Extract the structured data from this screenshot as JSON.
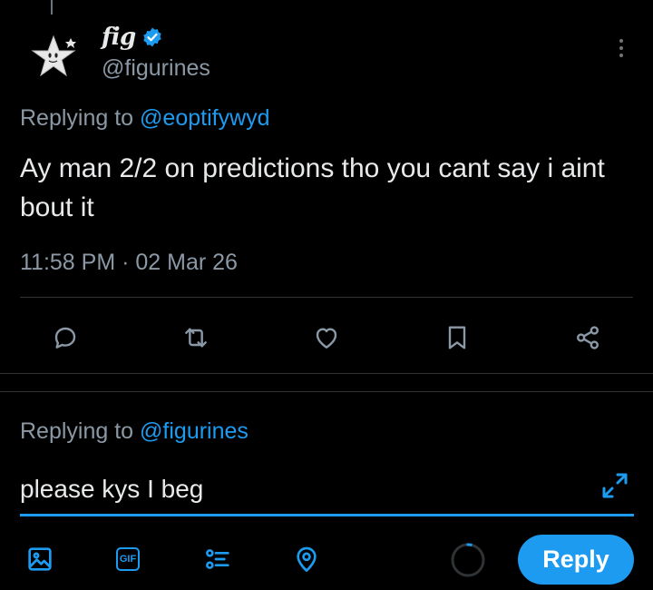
{
  "tweet": {
    "display_name": "fig",
    "handle": "@figurines",
    "replying_prefix": "Replying to ",
    "replying_to": "@eoptifywyd",
    "text": "Ay man 2/2 on predictions tho you cant say i aint bout it",
    "timestamp": "11:58 PM · 02 Mar 26",
    "verified": true
  },
  "actions": [
    "reply-icon",
    "retweet-icon",
    "like-icon",
    "bookmark-icon",
    "share-icon"
  ],
  "compose": {
    "replying_prefix": "Replying to ",
    "replying_to": "@figurines",
    "value": "please kys I beg",
    "gif_label": "GIF",
    "reply_button_label": "Reply"
  },
  "colors": {
    "accent": "#1d9bf0",
    "background": "#000000",
    "text": "#e7e9ea",
    "muted": "#8b98a5",
    "icon": "#8b98a5",
    "divider": "#2f3336"
  }
}
